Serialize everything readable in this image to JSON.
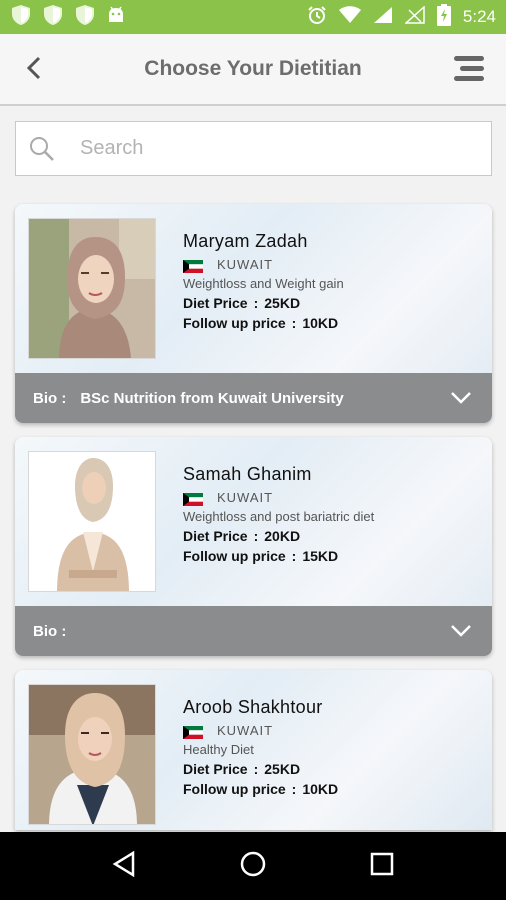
{
  "status_bar": {
    "time": "5:24",
    "left_icons": [
      "shield-icon",
      "shield-icon",
      "shield-icon",
      "android-icon"
    ],
    "right_icons": [
      "alarm-icon",
      "wifi-icon",
      "signal-icon",
      "signal-empty-icon",
      "battery-icon"
    ],
    "color": "#8bc34a"
  },
  "toolbar": {
    "title": "Choose Your Dietitian",
    "back_icon": "chevron-left-icon",
    "menu_icon": "menu-icon"
  },
  "search": {
    "placeholder": "Search",
    "value": ""
  },
  "dietitians": [
    {
      "name": "Maryam Zadah",
      "country": "KUWAIT",
      "specialty": "Weightloss and Weight gain",
      "diet_price_label": "Diet Price",
      "diet_price": "25KD",
      "followup_label": "Follow up price",
      "followup_price": "10KD",
      "bio_label": "Bio :",
      "bio": "BSc Nutrition from Kuwait University"
    },
    {
      "name": "Samah Ghanim",
      "country": "KUWAIT",
      "specialty": "Weightloss and post bariatric diet",
      "diet_price_label": "Diet Price",
      "diet_price": "20KD",
      "followup_label": "Follow up price",
      "followup_price": "15KD",
      "bio_label": "Bio :",
      "bio": ""
    },
    {
      "name": "Aroob Shakhtour",
      "country": "KUWAIT",
      "specialty": "Healthy Diet",
      "diet_price_label": "Diet Price",
      "diet_price": "25KD",
      "followup_label": "Follow up price",
      "followup_price": "10KD"
    }
  ],
  "nav_bar": {
    "back_icon": "triangle-back-icon",
    "home_icon": "circle-home-icon",
    "recents_icon": "square-recents-icon"
  }
}
